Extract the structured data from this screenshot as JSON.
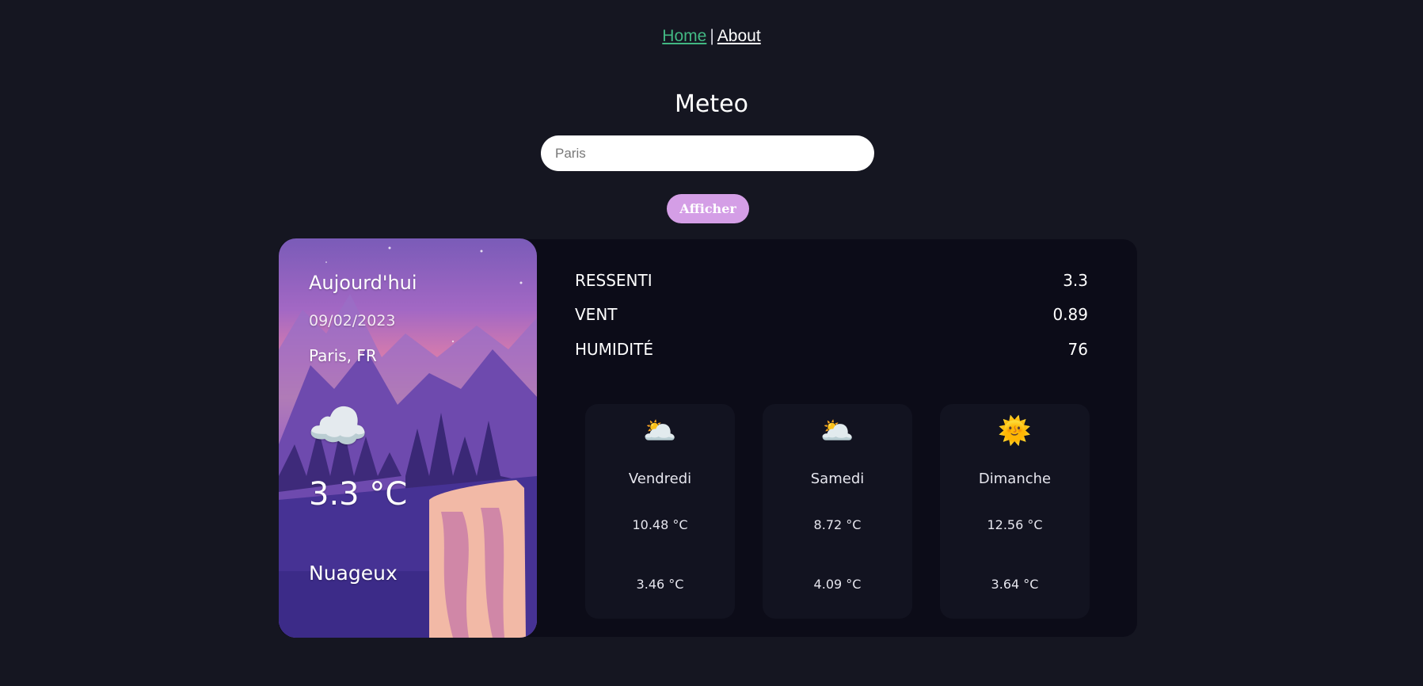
{
  "nav": {
    "home": "Home",
    "separator": "|",
    "about": "About"
  },
  "title": "Meteo",
  "search": {
    "value": "",
    "placeholder": "Paris"
  },
  "button_label": "Afficher",
  "today": {
    "day": "Aujourd'hui",
    "date": "09/02/2023",
    "city": "Paris, FR",
    "icon": "☁️",
    "icon_name": "cloudy-icon",
    "temperature": "3.3 °C",
    "description": "Nuageux"
  },
  "stats": [
    {
      "name": "RESSENTI",
      "value": "3.3"
    },
    {
      "name": "VENT",
      "value": "0.89"
    },
    {
      "name": "HUMIDITÉ",
      "value": "76"
    }
  ],
  "forecast": [
    {
      "icon": "🌥️",
      "icon_name": "cloudy-icon",
      "day": "Vendredi",
      "max": "10.48 °C",
      "min": "3.46 °C"
    },
    {
      "icon": "🌥️",
      "icon_name": "cloudy-icon",
      "day": "Samedi",
      "max": "8.72 °C",
      "min": "4.09 °C"
    },
    {
      "icon": "🌞",
      "icon_name": "sun-icon",
      "day": "Dimanche",
      "max": "12.56 °C",
      "min": "3.64 °C"
    }
  ],
  "colors": {
    "background": "#151621",
    "panel": "#0c0c18",
    "card": "#121320",
    "home_link": "#42b883",
    "button": "#d49ee6"
  }
}
